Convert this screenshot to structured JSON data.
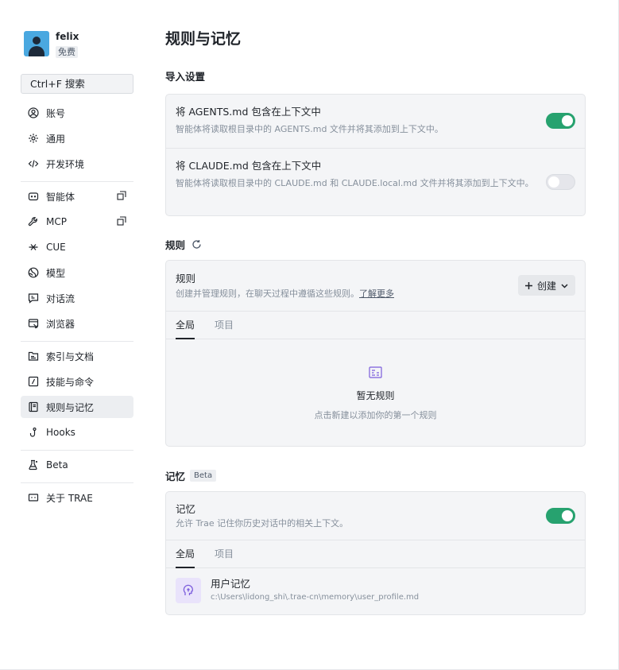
{
  "user": {
    "name": "felix",
    "plan": "免费"
  },
  "search": {
    "label": "Ctrl+F 搜索"
  },
  "sidebar": {
    "groups": [
      [
        {
          "label": "账号"
        },
        {
          "label": "通用"
        },
        {
          "label": "开发环境"
        }
      ],
      [
        {
          "label": "智能体"
        },
        {
          "label": "MCP"
        },
        {
          "label": "CUE"
        },
        {
          "label": "模型"
        },
        {
          "label": "对话流"
        },
        {
          "label": "浏览器"
        }
      ],
      [
        {
          "label": "索引与文档"
        },
        {
          "label": "技能与命令"
        },
        {
          "label": "规则与记忆"
        },
        {
          "label": "Hooks"
        }
      ],
      [
        {
          "label": "Beta"
        }
      ],
      [
        {
          "label": "关于 TRAE"
        }
      ]
    ]
  },
  "page": {
    "title": "规则与记忆"
  },
  "import_settings": {
    "title": "导入设置",
    "rows": [
      {
        "title": "将 AGENTS.md 包含在上下文中",
        "desc": "智能体将读取根目录中的 AGENTS.md 文件并将其添加到上下文中。",
        "enabled": true
      },
      {
        "title": "将 CLAUDE.md 包含在上下文中",
        "desc": "智能体将读取根目录中的 CLAUDE.md 和 CLAUDE.local.md 文件并将其添加到上下文中。",
        "enabled": false
      }
    ]
  },
  "rules": {
    "section_title": "规则",
    "card_title": "规则",
    "desc": "创建并管理规则，在聊天过程中遵循这些规则。",
    "learn_more": "了解更多",
    "create_label": "创建",
    "tabs": [
      "全局",
      "项目"
    ],
    "empty_title": "暂无规则",
    "empty_desc": "点击新建以添加你的第一个规则"
  },
  "memory": {
    "section_title": "记忆",
    "beta_badge": "Beta",
    "card_title": "记忆",
    "desc": "允许 Trae 记住你历史对话中的相关上下文。",
    "enabled": true,
    "tabs": [
      "全局",
      "项目"
    ],
    "item_title": "用户记忆",
    "item_path": "c:\\Users\\lidong_shi\\.trae-cn\\memory\\user_profile.md"
  },
  "colors": {
    "toggle_on": "#27a26f",
    "accent_purple": "#7b5cdc"
  }
}
